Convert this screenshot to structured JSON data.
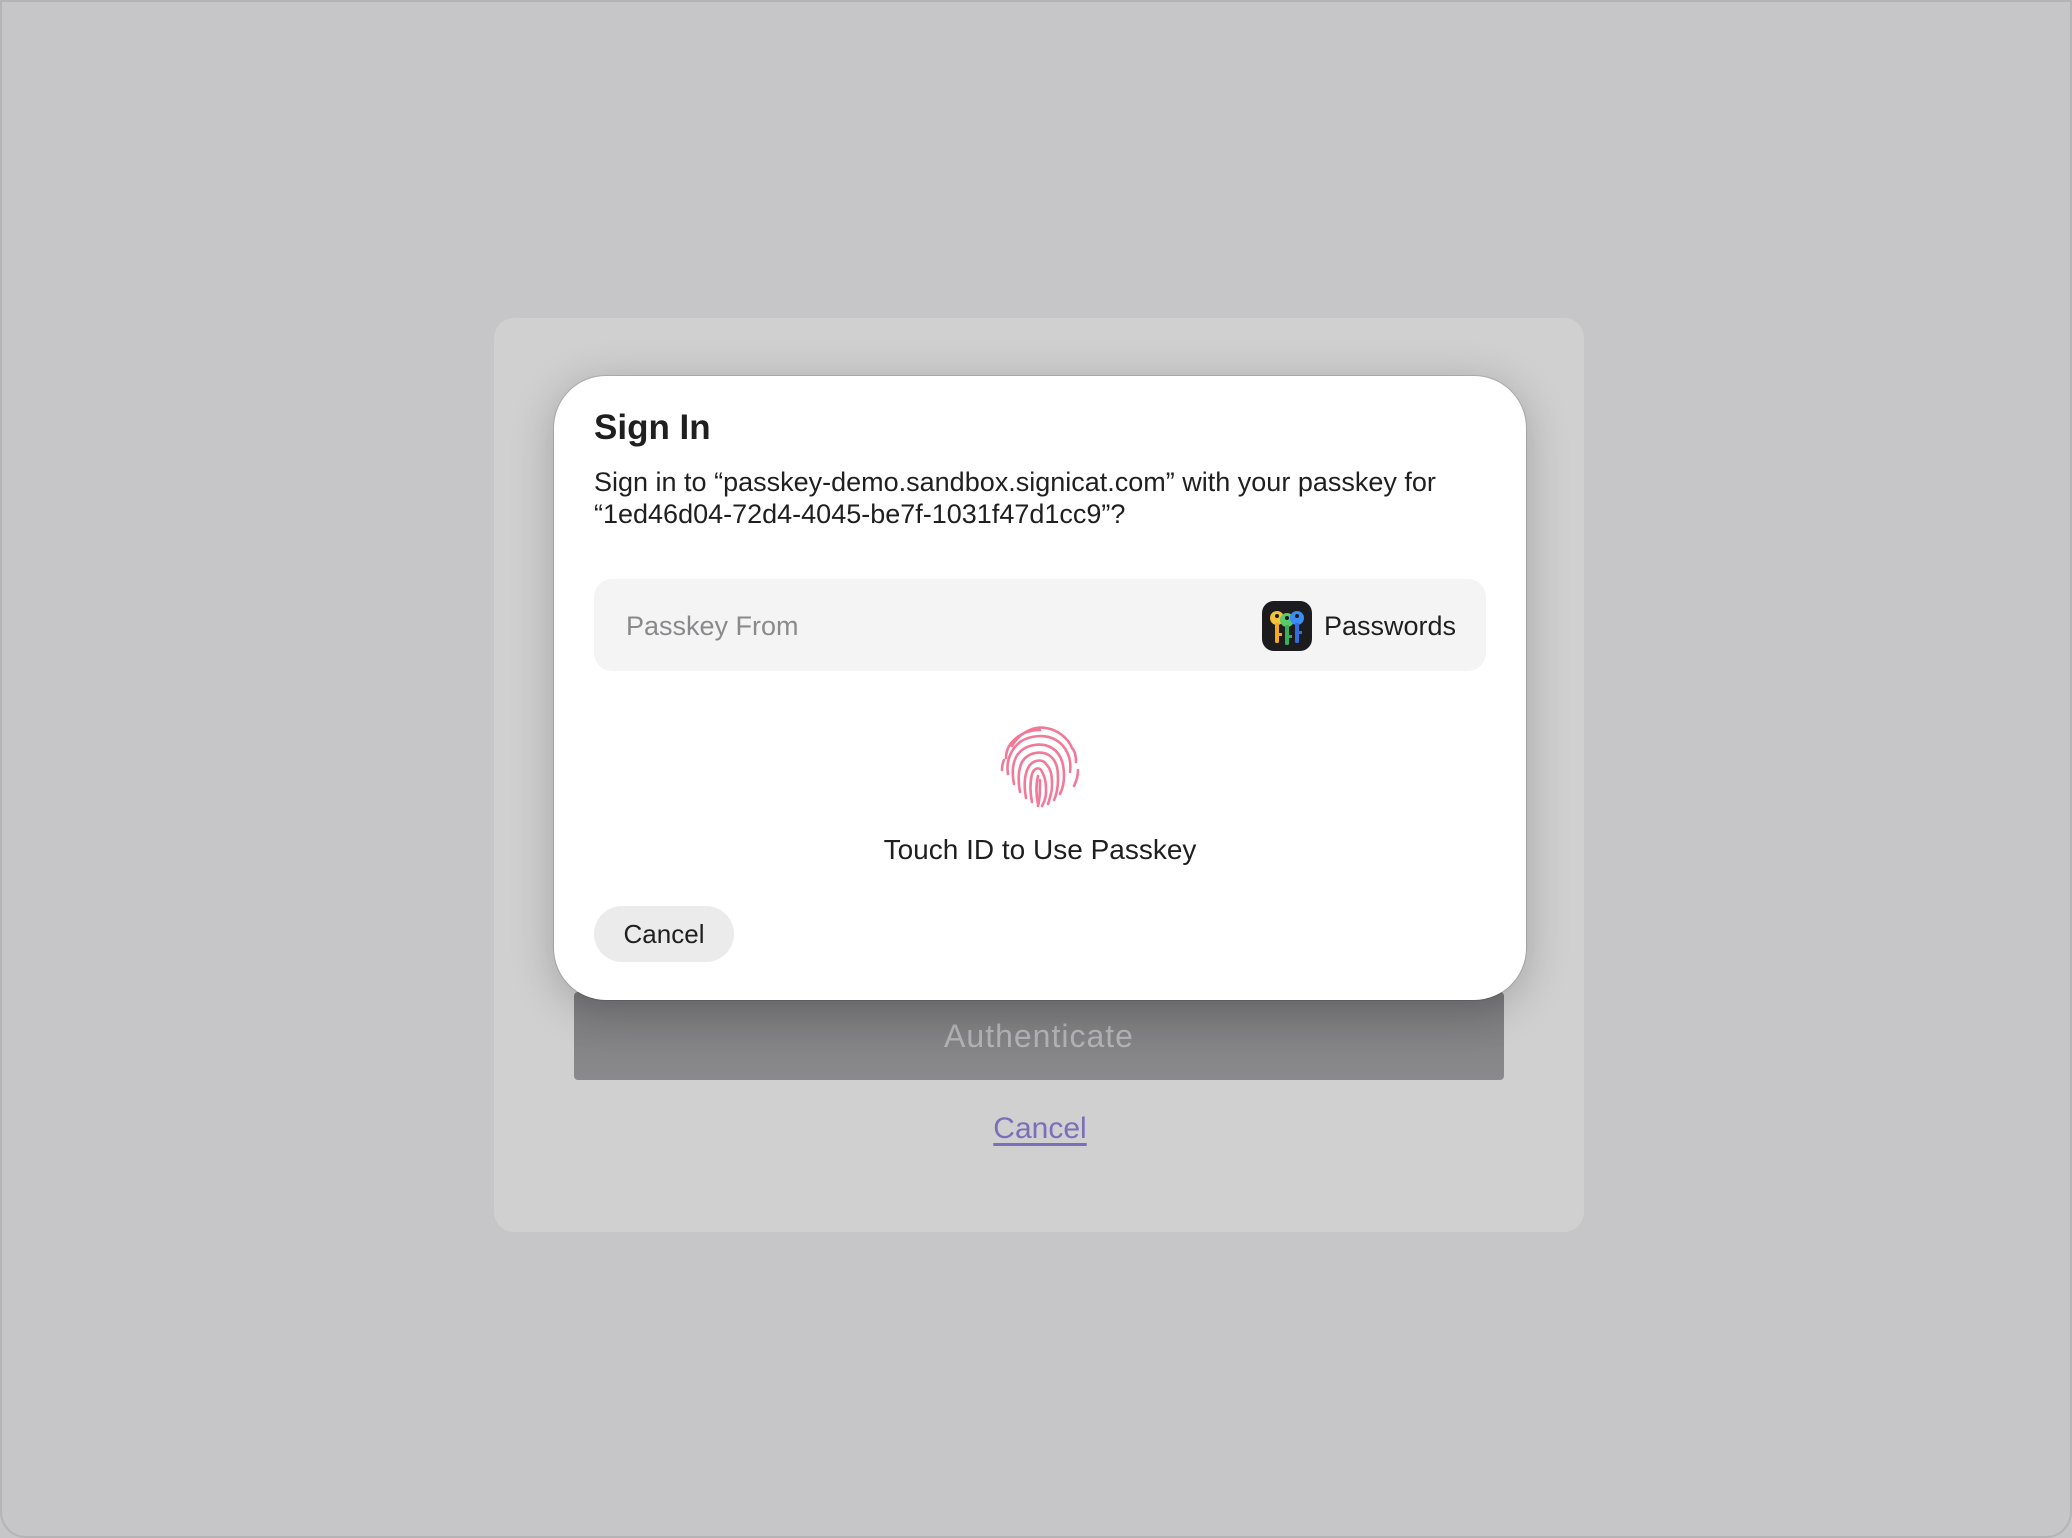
{
  "background_page": {
    "authenticate_label": "Authenticate",
    "cancel_link": "Cancel"
  },
  "sheet": {
    "title": "Sign In",
    "message_line1": "Sign in to “passkey-demo.sandbox.signicat.com” with your passkey for",
    "message_line2": "“1ed46d04-72d4-4045-be7f-1031f47d1cc9”?",
    "passkey_from_label": "Passkey From",
    "passkey_source": "Passwords",
    "passkey_source_icon": "passwords-app-icon",
    "biometric_icon": "fingerprint-icon",
    "touch_id_caption": "Touch ID to Use Passkey",
    "cancel_label": "Cancel"
  },
  "colors": {
    "backdrop": "#c6c6c8",
    "fingerprint": "#f07a98",
    "link": "#7a6fb8"
  }
}
